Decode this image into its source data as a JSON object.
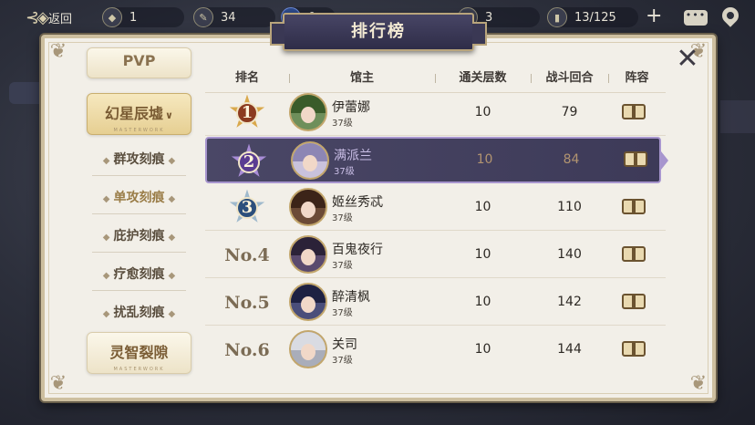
{
  "topbar": {
    "back_label": "返回",
    "resources": [
      {
        "icon": "shield-coin-icon",
        "value": "1"
      },
      {
        "icon": "feather-coin-icon",
        "value": "34"
      },
      {
        "icon": "blue-gem-icon",
        "value": "0"
      },
      {
        "icon": "gold-coin-icon",
        "value": "3"
      },
      {
        "icon": "stamina-icon",
        "value": "13/125"
      }
    ]
  },
  "panel": {
    "title": "排行榜"
  },
  "menu": {
    "top_card": "PVP",
    "active_card": "幻星辰墟",
    "active_card_sub": "MASTERWORK",
    "items": [
      "群攻刻痕",
      "单攻刻痕",
      "庇护刻痕",
      "疗愈刻痕",
      "扰乱刻痕"
    ],
    "bottom_card": "灵智裂隙",
    "bottom_card_sub": "MASTERWORK"
  },
  "table": {
    "headers": {
      "rank": "排名",
      "owner": "馆主",
      "floors": "通关层数",
      "rounds": "战斗回合",
      "lineup": "阵容"
    },
    "rows": [
      {
        "rank": "1",
        "name": "伊蕾娜",
        "level": "37级",
        "floors": "10",
        "rounds": "79"
      },
      {
        "rank": "2",
        "name": "满派兰",
        "level": "37级",
        "floors": "10",
        "rounds": "84",
        "highlight": true
      },
      {
        "rank": "3",
        "name": "姬丝秀忒",
        "level": "37级",
        "floors": "10",
        "rounds": "110"
      },
      {
        "rank": "No.4",
        "name": "百鬼夜行",
        "level": "37级",
        "floors": "10",
        "rounds": "140"
      },
      {
        "rank": "No.5",
        "name": "醉清枫",
        "level": "37级",
        "floors": "10",
        "rounds": "142"
      },
      {
        "rank": "No.6",
        "name": "关司",
        "level": "37级",
        "floors": "10",
        "rounds": "144"
      }
    ]
  },
  "colors": {
    "highlight_row": "#423f5e",
    "panel_bg": "#f2efe8",
    "gold": "#c2a66c"
  }
}
